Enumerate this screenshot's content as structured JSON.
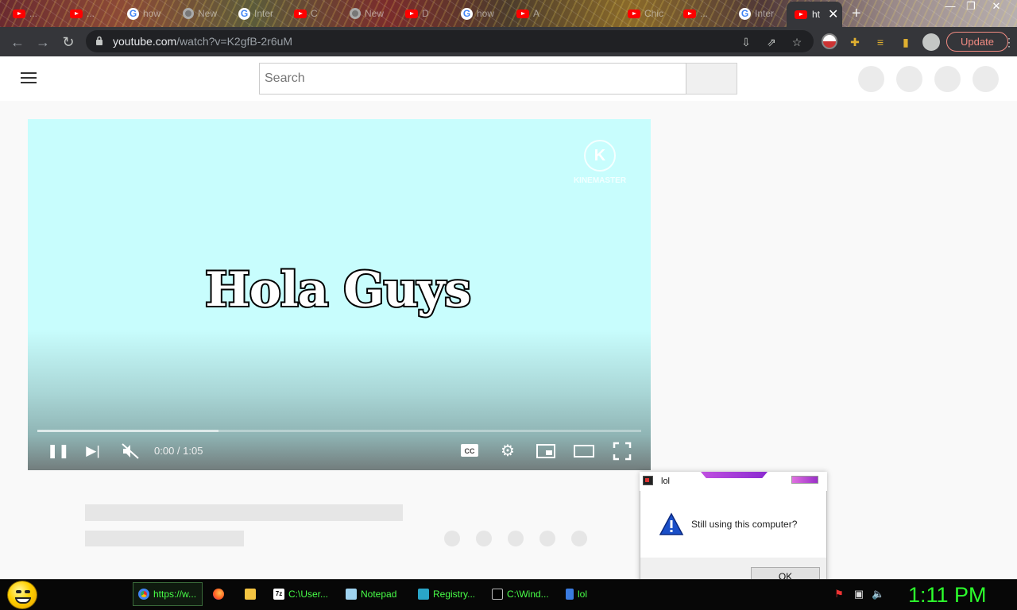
{
  "browser": {
    "tabs": [
      {
        "icon": "youtube",
        "label": "..."
      },
      {
        "icon": "youtube",
        "label": "..."
      },
      {
        "icon": "google",
        "label": "how"
      },
      {
        "icon": "chrome",
        "label": "New"
      },
      {
        "icon": "google",
        "label": "Inter"
      },
      {
        "icon": "youtube",
        "label": "C"
      },
      {
        "icon": "chrome",
        "label": "New"
      },
      {
        "icon": "youtube",
        "label": "D"
      },
      {
        "icon": "google",
        "label": "how"
      },
      {
        "icon": "youtube",
        "label": "A"
      },
      {
        "icon": "youtube",
        "label": "Chic"
      },
      {
        "icon": "youtube",
        "label": "..."
      },
      {
        "icon": "google",
        "label": "Inter"
      }
    ],
    "active_tab": {
      "icon": "youtube",
      "label": "ht"
    },
    "new_tab": "+",
    "window_controls": {
      "minimize": "—",
      "restore": "❐",
      "close": "✕"
    },
    "url": {
      "host": "youtube.com",
      "path": "/watch?v=K2gfB-2r6uM"
    },
    "update_label": "Update"
  },
  "youtube": {
    "search_placeholder": "Search",
    "video": {
      "title_overlay": "Hola Guys",
      "watermark": "KINEMASTER",
      "time_current": "0:00",
      "time_total": "1:05",
      "timecode": "0:00 / 1:05",
      "buffered_fraction": 0.3,
      "muted": true
    }
  },
  "dialog": {
    "title": "lol",
    "message": "Still using this computer?",
    "ok_label": "OK"
  },
  "taskbar": {
    "items": [
      {
        "label": "https://w...",
        "icon": "chrome",
        "active": true
      },
      {
        "label": "",
        "icon": "firefox"
      },
      {
        "label": "",
        "icon": "folder"
      },
      {
        "label": "C:\\User...",
        "icon": "7zip"
      },
      {
        "label": "Notepad",
        "icon": "notepad"
      },
      {
        "label": "Registry...",
        "icon": "registry"
      },
      {
        "label": "C:\\Wind...",
        "icon": "cmd"
      },
      {
        "label": "lol",
        "icon": "app"
      }
    ],
    "clock": "1:11 PM"
  },
  "colors": {
    "video_sky": "#c8fdfd",
    "youtube_red": "#ff0000",
    "update_red": "#f28b82",
    "taskbar_text": "#48ff48",
    "clock": "#2cff2c",
    "dialog_accent": "#c050e0"
  }
}
